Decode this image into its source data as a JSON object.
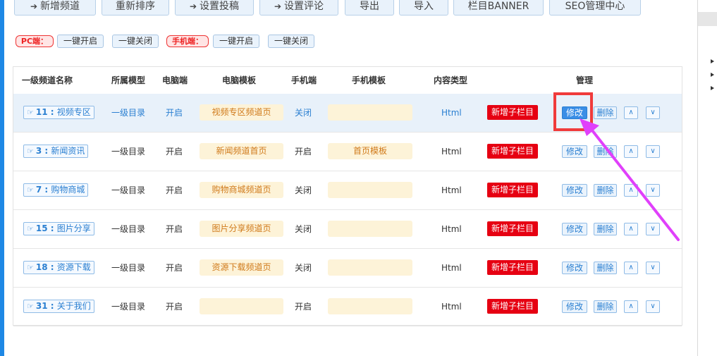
{
  "toolbar": [
    {
      "label": "新增频道",
      "icon": "➔"
    },
    {
      "label": "重新排序",
      "icon": ""
    },
    {
      "label": "设置投稿",
      "icon": "➔"
    },
    {
      "label": "设置评论",
      "icon": "➔"
    },
    {
      "label": "导出",
      "icon": ""
    },
    {
      "label": "导入",
      "icon": ""
    },
    {
      "label": "栏目BANNER",
      "icon": ""
    },
    {
      "label": "SEO管理中心",
      "icon": ""
    }
  ],
  "switches": {
    "pc_label": "PC端：",
    "mobile_label": "手机端：",
    "open_all": "一键开启",
    "close_all": "一键关闭"
  },
  "table": {
    "headers": [
      "一级频道名称",
      "所属模型",
      "电脑端",
      "电脑模板",
      "手机端",
      "手机模板",
      "内容类型",
      "管理"
    ],
    "rows": [
      {
        "id": "11",
        "name": "视频专区",
        "model": "一级目录",
        "pc": "开启",
        "pc_tpl": "视频专区频道页",
        "mobile": "关闭",
        "mobile_tpl": "",
        "type": "Html",
        "highlighted": true
      },
      {
        "id": "3",
        "name": "新闻资讯",
        "model": "一级目录",
        "pc": "开启",
        "pc_tpl": "新闻频道首页",
        "mobile": "开启",
        "mobile_tpl": "首页模板",
        "type": "Html",
        "highlighted": false
      },
      {
        "id": "7",
        "name": "购物商城",
        "model": "一级目录",
        "pc": "开启",
        "pc_tpl": "购物商城频道页",
        "mobile": "关闭",
        "mobile_tpl": "",
        "type": "Html",
        "highlighted": false
      },
      {
        "id": "15",
        "name": "图片分享",
        "model": "一级目录",
        "pc": "开启",
        "pc_tpl": "图片分享频道页",
        "mobile": "关闭",
        "mobile_tpl": "",
        "type": "Html",
        "highlighted": false
      },
      {
        "id": "18",
        "name": "资源下载",
        "model": "一级目录",
        "pc": "开启",
        "pc_tpl": "资源下载频道页",
        "mobile": "关闭",
        "mobile_tpl": "",
        "type": "Html",
        "highlighted": false
      },
      {
        "id": "31",
        "name": "关于我们",
        "model": "一级目录",
        "pc": "开启",
        "pc_tpl": "",
        "mobile": "开启",
        "mobile_tpl": "",
        "type": "Html",
        "highlighted": false
      }
    ],
    "actions": {
      "add_sub": "新增子栏目",
      "edit": "修改",
      "delete": "删除",
      "up": "∧",
      "down": "∨"
    }
  },
  "colors": {
    "accent": "#2a7fd1",
    "danger": "#e60012",
    "annotation": "#e040fb",
    "highlight_box": "#f03b3b"
  }
}
